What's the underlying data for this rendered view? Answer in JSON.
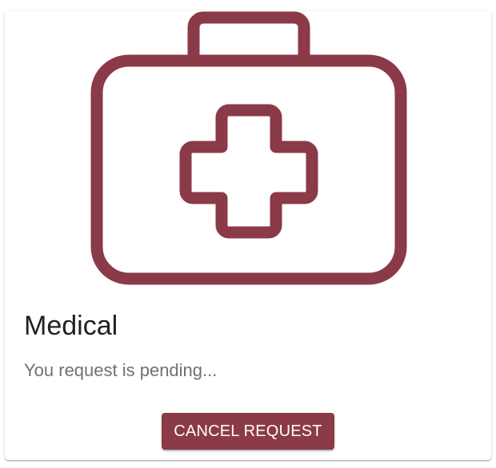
{
  "card": {
    "icon": "medical-kit-icon",
    "title": "Medical",
    "status": "You request is pending...",
    "cancel_label": "CANCEL REQUEST"
  },
  "colors": {
    "accent": "#8b3a48",
    "title_text": "#212121",
    "status_text": "#707070",
    "background": "#ffffff"
  }
}
